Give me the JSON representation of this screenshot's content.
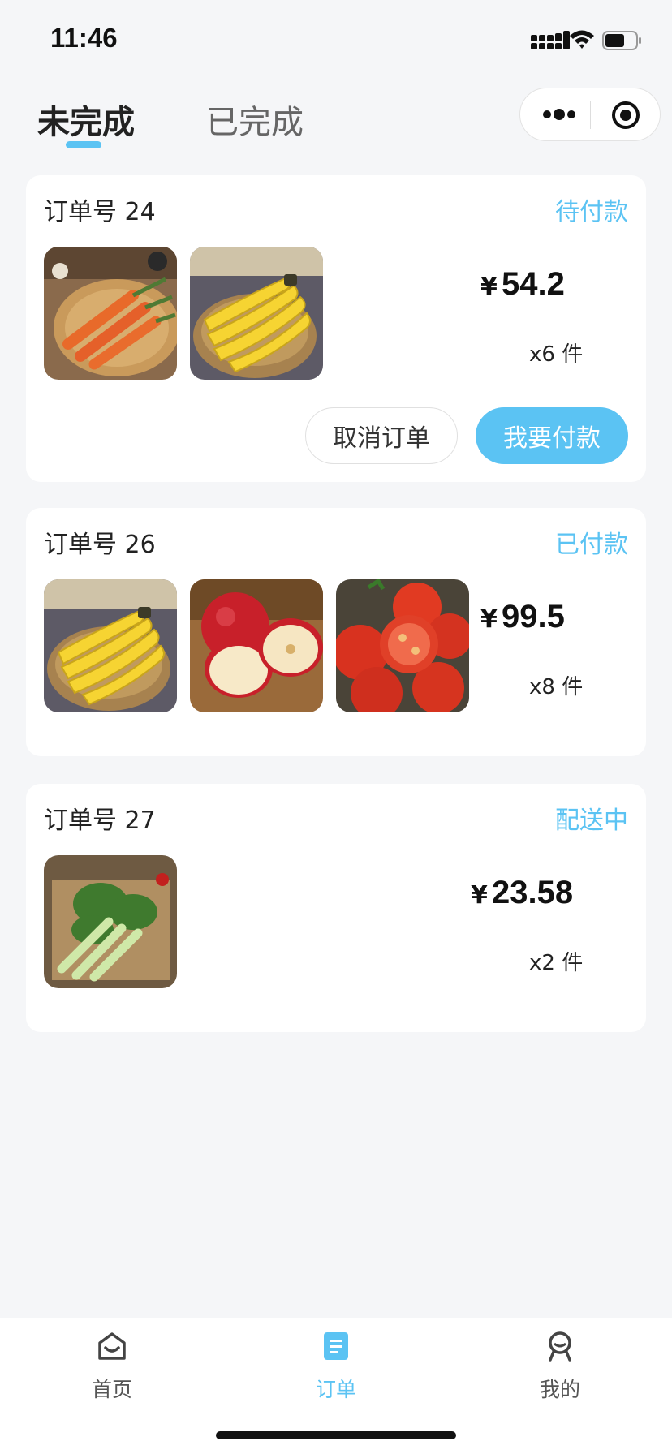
{
  "status_bar": {
    "time": "11:46"
  },
  "tabs": [
    {
      "label": "未完成",
      "active": true
    },
    {
      "label": "已完成",
      "active": false
    }
  ],
  "accent_color": "#5bc3f3",
  "orders": [
    {
      "title": "订单号 24",
      "status": "待付款",
      "images": [
        "carrot",
        "banana"
      ],
      "currency": "¥",
      "price": "54.2",
      "count": "x6 件",
      "actions": {
        "cancel_label": "取消订单",
        "pay_label": "我要付款"
      }
    },
    {
      "title": "订单号 26",
      "status": "已付款",
      "images": [
        "banana",
        "apple",
        "tomato"
      ],
      "currency": "¥",
      "price": "99.5",
      "count": "x8 件"
    },
    {
      "title": "订单号 27",
      "status": "配送中",
      "images": [
        "bok-choy"
      ],
      "currency": "¥",
      "price": "23.58",
      "count": "x2 件"
    }
  ],
  "bottom_nav": [
    {
      "label": "首页",
      "icon": "home-icon",
      "active": false
    },
    {
      "label": "订单",
      "icon": "order-icon",
      "active": true
    },
    {
      "label": "我的",
      "icon": "profile-icon",
      "active": false
    }
  ]
}
